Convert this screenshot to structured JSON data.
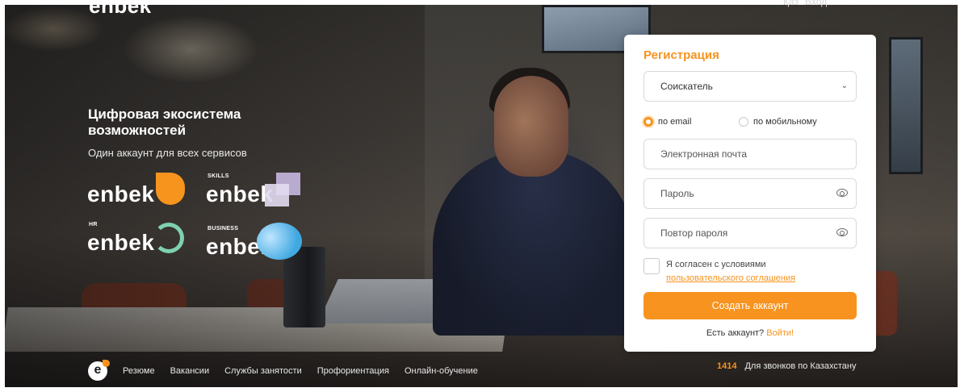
{
  "header": {
    "logo": "enbek",
    "lang": "Қаз",
    "login": "Вход"
  },
  "hero": {
    "headline": "Цифровая экосистема возможностей",
    "subline": "Один аккаунт для всех сервисов"
  },
  "brands": [
    {
      "name": "enbek",
      "tag": ""
    },
    {
      "name": "enbek",
      "tag": "SKILLS"
    },
    {
      "name": "enbek",
      "tag": "HR"
    },
    {
      "name": "enbek",
      "tag": "BUSINESS"
    }
  ],
  "form": {
    "title": "Регистрация",
    "role_select": {
      "value": "Соискатель"
    },
    "radio_email": "по email",
    "radio_mobile": "по мобильному",
    "email_placeholder": "Электронная почта",
    "password_placeholder": "Пароль",
    "password_repeat_placeholder": "Повтор пароля",
    "agree_text": "Я согласен с условиями",
    "agree_link": "пользовательского соглашения",
    "submit": "Создать аккаунт",
    "have_account": "Есть аккаунт?",
    "login_link": "Войти!"
  },
  "footer": {
    "logo_letter": "e",
    "links": [
      "Резюме",
      "Вакансии",
      "Службы занятости",
      "Профориентация",
      "Онлайн-обучение"
    ],
    "hotline_number": "1414",
    "hotline_text": "Для звонков по Казахстану"
  },
  "colors": {
    "accent": "#f7931e",
    "card": "#ffffff"
  }
}
